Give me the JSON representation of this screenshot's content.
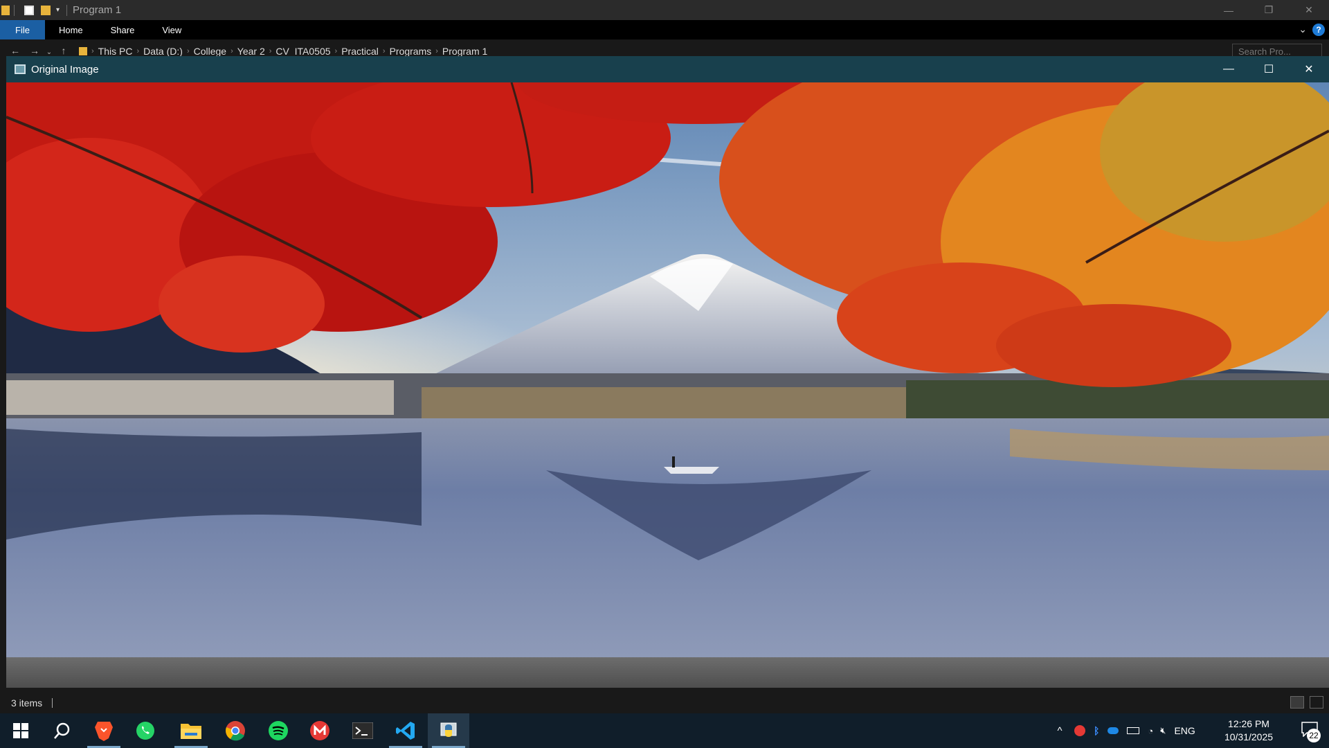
{
  "explorer": {
    "title": "Program 1",
    "ribbon_tabs": [
      "File",
      "Home",
      "Share",
      "View"
    ],
    "help_label": "?",
    "breadcrumb": [
      "This PC",
      "Data (D:)",
      "College",
      "Year 2",
      "CV_ITA0505",
      "Practical",
      "Programs",
      "Program 1"
    ],
    "search_placeholder": "Search Pro...",
    "status_items": "3 items"
  },
  "image_window": {
    "title": "Original Image",
    "icon": "image-window-icon"
  },
  "taskbar": {
    "apps": [
      "windows-start-icon",
      "search-icon",
      "brave-icon",
      "whatsapp-icon",
      "file-explorer-icon",
      "chrome-icon",
      "spotify-icon",
      "gmail-icon",
      "terminal-icon",
      "vscode-icon",
      "python-icon"
    ],
    "tray": {
      "language": "ENG",
      "time": "12:26 PM",
      "date": "10/31/2025",
      "notification_count": "22"
    }
  },
  "colors": {
    "image_window_titlebar": "#18404d",
    "file_tab": "#1b5fa3",
    "taskbar": "#101e2a"
  }
}
